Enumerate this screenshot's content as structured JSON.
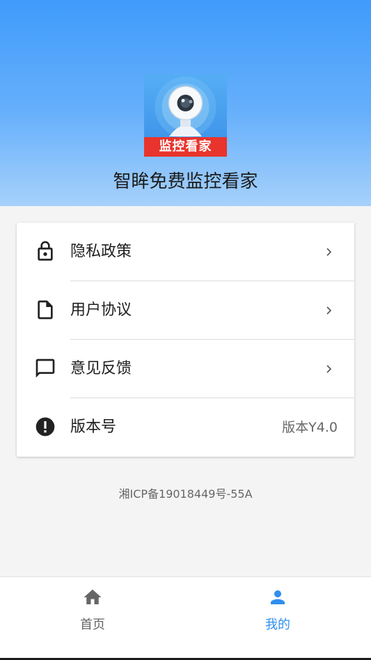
{
  "header": {
    "app_title": "智眸免费监控看家",
    "logo_text": "监控看家"
  },
  "menu": {
    "privacy_policy": "隐私政策",
    "user_agreement": "用户协议",
    "feedback": "意见反馈",
    "version_label": "版本号",
    "version_value": "版本Y4.0"
  },
  "footer": {
    "icp": "湘ICP备19018449号-55A"
  },
  "bottom_nav": {
    "home": "首页",
    "mine": "我的"
  },
  "colors": {
    "header_top": "#3f9bfb",
    "header_bottom": "#a6d1fb",
    "active_tab": "#2f8ef0",
    "inactive_tab": "#666666",
    "logo_band": "#e8342c"
  }
}
